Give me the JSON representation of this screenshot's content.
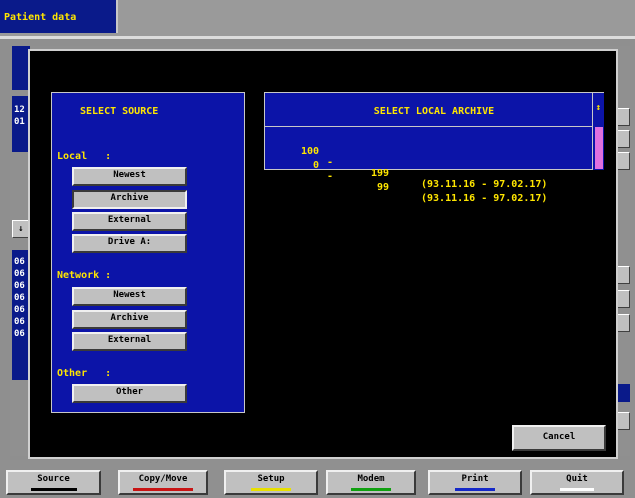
{
  "window": {
    "title": "Patient data"
  },
  "background": {
    "left_numbers": [
      "12",
      "01"
    ],
    "list_numbers": [
      "06",
      "06",
      "06",
      "06",
      "06",
      "06",
      "06"
    ],
    "arrow": "↓"
  },
  "source_panel": {
    "title": "SELECT SOURCE",
    "local": {
      "label": "Local   :",
      "buttons": [
        "Newest",
        "Archive",
        "External",
        "Drive A:"
      ]
    },
    "network": {
      "label": "Network :",
      "buttons": [
        "Newest",
        "Archive",
        "External"
      ]
    },
    "other": {
      "label": "Other   :",
      "buttons": [
        "Other"
      ]
    }
  },
  "archive_panel": {
    "title": "SELECT LOCAL ARCHIVE",
    "scroll_icon": "↕",
    "rows": [
      {
        "from": "100",
        "to": "199",
        "dates": "(93.11.16 - 97.02.17)"
      },
      {
        "from": "0",
        "to": "99",
        "dates": "(93.11.16 - 97.02.17)"
      }
    ]
  },
  "cancel_label": "Cancel",
  "toolbar": [
    {
      "label": "Source",
      "underline": "#000000"
    },
    {
      "label": "Copy/Move",
      "underline": "#c81414"
    },
    {
      "label": "Setup",
      "underline": "#e8e000"
    },
    {
      "label": "Modem",
      "underline": "#10a010"
    },
    {
      "label": "Print",
      "underline": "#1428c8"
    },
    {
      "label": "Quit",
      "underline": "#ffffff"
    }
  ],
  "colors": {
    "panel_blue": "#0c14a8",
    "label_yellow": "#ffe600",
    "button_gray": "#c0c0c0",
    "scroll_thumb": "#e070e0"
  }
}
